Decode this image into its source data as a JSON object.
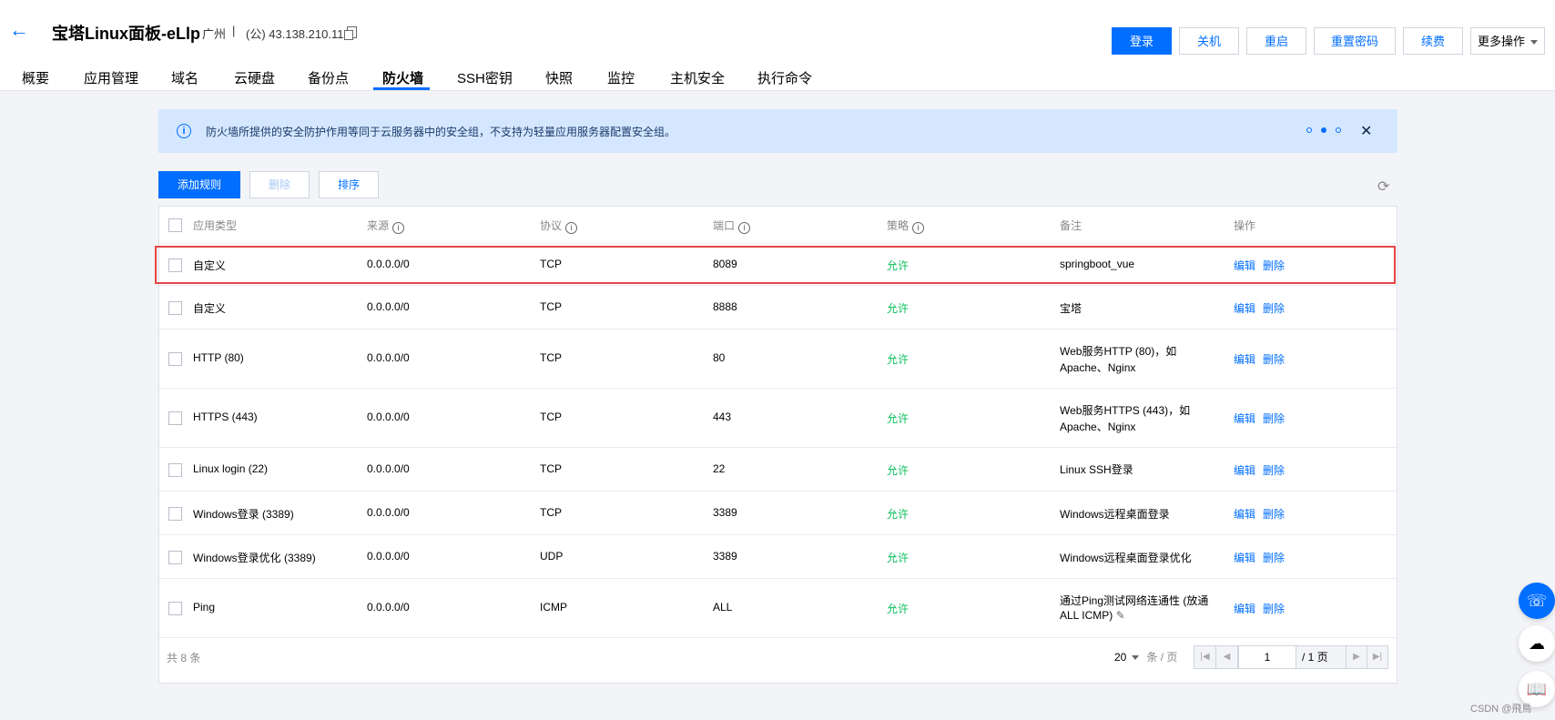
{
  "header": {
    "title": "宝塔Linux面板-eLlp",
    "region": "广州",
    "separator": "|",
    "ip": "(公) 43.138.210.113",
    "buttons": {
      "login": "登录",
      "shutdown": "关机",
      "restart": "重启",
      "reset_password": "重置密码",
      "renew": "续费",
      "more": "更多操作"
    }
  },
  "tabs": [
    "概要",
    "应用管理",
    "域名",
    "云硬盘",
    "备份点",
    "防火墙",
    "SSH密钥",
    "快照",
    "监控",
    "主机安全",
    "执行命令"
  ],
  "active_tab": "防火墙",
  "notice": {
    "text": "防火墙所提供的安全防护作用等同于云服务器中的安全组，不支持为轻量应用服务器配置安全组。"
  },
  "actions": {
    "add_rule": "添加规则",
    "delete": "删除",
    "sort": "排序"
  },
  "table": {
    "columns": [
      "应用类型",
      "来源",
      "协议",
      "端口",
      "策略",
      "备注",
      "操作"
    ],
    "rows": [
      {
        "type": "自定义",
        "source": "0.0.0.0/0",
        "protocol": "TCP",
        "port": "8089",
        "policy": "允许",
        "remark": "springboot_vue",
        "remark2": "",
        "edit": "编辑",
        "del": "删除"
      },
      {
        "type": "自定义",
        "source": "0.0.0.0/0",
        "protocol": "TCP",
        "port": "8888",
        "policy": "允许",
        "remark": "宝塔",
        "remark2": "",
        "edit": "编辑",
        "del": "删除"
      },
      {
        "type": "HTTP (80)",
        "source": "0.0.0.0/0",
        "protocol": "TCP",
        "port": "80",
        "policy": "允许",
        "remark": "Web服务HTTP (80)，如",
        "remark2": "Apache、Nginx",
        "edit": "编辑",
        "del": "删除"
      },
      {
        "type": "HTTPS (443)",
        "source": "0.0.0.0/0",
        "protocol": "TCP",
        "port": "443",
        "policy": "允许",
        "remark": "Web服务HTTPS (443)，如",
        "remark2": "Apache、Nginx",
        "edit": "编辑",
        "del": "删除"
      },
      {
        "type": "Linux login (22)",
        "source": "0.0.0.0/0",
        "protocol": "TCP",
        "port": "22",
        "policy": "允许",
        "remark": "Linux SSH登录",
        "remark2": "",
        "edit": "编辑",
        "del": "删除"
      },
      {
        "type": "Windows登录 (3389)",
        "source": "0.0.0.0/0",
        "protocol": "TCP",
        "port": "3389",
        "policy": "允许",
        "remark": "Windows远程桌面登录",
        "remark2": "",
        "edit": "编辑",
        "del": "删除"
      },
      {
        "type": "Windows登录优化 (3389)",
        "source": "0.0.0.0/0",
        "protocol": "UDP",
        "port": "3389",
        "policy": "允许",
        "remark": "Windows远程桌面登录优化",
        "remark2": "",
        "edit": "编辑",
        "del": "删除"
      },
      {
        "type": "Ping",
        "source": "0.0.0.0/0",
        "protocol": "ICMP",
        "port": "ALL",
        "policy": "允许",
        "remark": "通过Ping测试网络连通性 (放通",
        "remark2": "ALL ICMP)",
        "edit": "编辑",
        "del": "删除"
      }
    ]
  },
  "footer": {
    "total": "共 8 条",
    "page_size": "20",
    "page_size_unit": "条 / 页",
    "current_page": "1",
    "total_pages": "/ 1 页"
  },
  "watermark": "CSDN @飛鳥"
}
